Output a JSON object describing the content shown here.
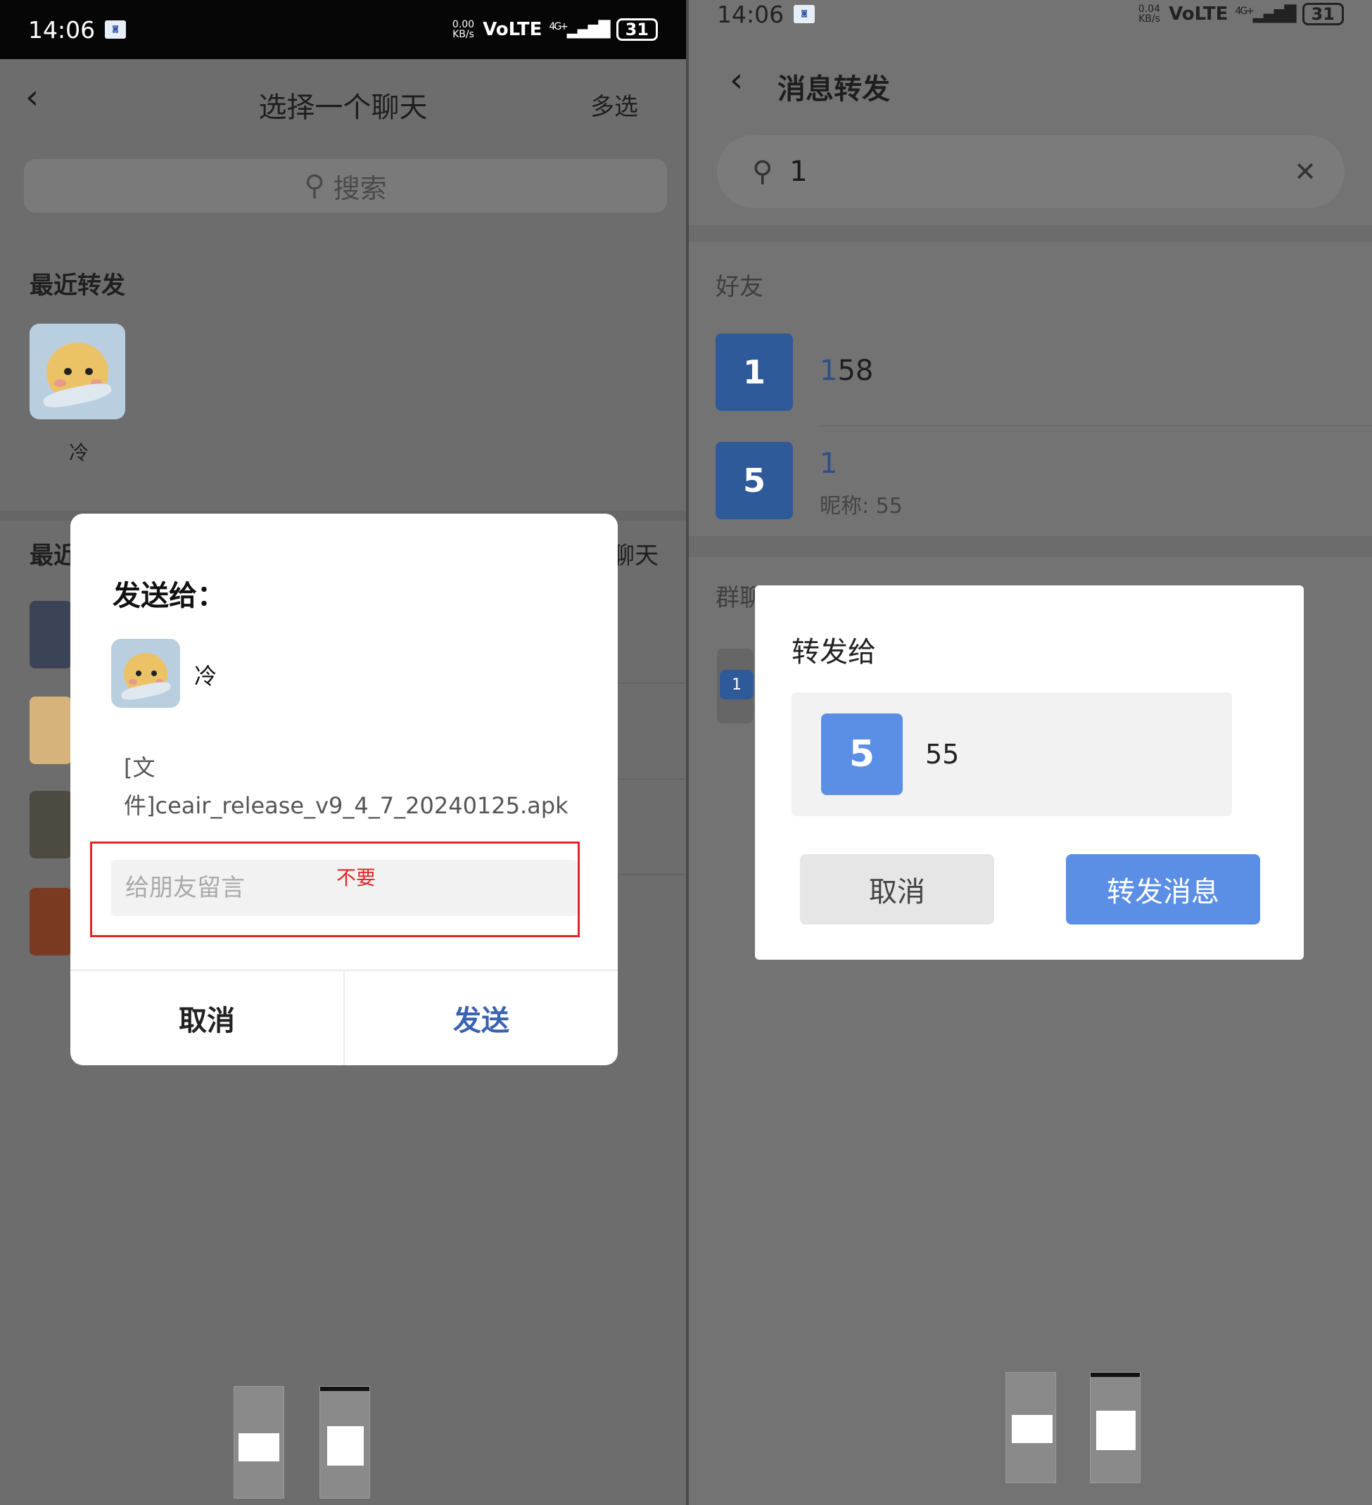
{
  "left": {
    "status": {
      "time": "14:06",
      "net_rate": "0.00",
      "net_unit": "KB/s",
      "volte": "VoLTE",
      "signal": "4G+",
      "battery": "31"
    },
    "header": {
      "title": "选择一个聊天",
      "multi_select": "多选"
    },
    "search": {
      "placeholder": "搜索"
    },
    "recent_forward": {
      "title": "最近转发",
      "items": [
        {
          "name": "冷"
        }
      ]
    },
    "recent_chats": {
      "title_fragment": "最近",
      "right_fragment": "聊天"
    },
    "dialog": {
      "title": "发送给：",
      "recipient": "冷",
      "file_line1": "[文",
      "file_line2": "件]ceair_release_v9_4_7_20240125.apk",
      "message_placeholder": "给朋友留言",
      "cancel": "取消",
      "send": "发送"
    },
    "annotation": {
      "text": "不要",
      "color": "#e12626"
    }
  },
  "right": {
    "status": {
      "time": "14:06",
      "net_rate": "0.04",
      "net_unit": "KB/s",
      "volte": "VoLTE",
      "signal": "4G+",
      "battery": "31"
    },
    "header": {
      "title": "消息转发"
    },
    "search": {
      "query": "1"
    },
    "friends": {
      "title": "好友",
      "items": [
        {
          "avatar": "1",
          "name_highlight": "1",
          "name_rest": "58"
        },
        {
          "avatar": "5",
          "name_highlight": "1",
          "nickname": "昵称: 55"
        }
      ]
    },
    "groups": {
      "title_fragment": "群聊",
      "avatar": "1"
    },
    "dialog": {
      "title": "转发给",
      "target_avatar": "5",
      "target_name": "55",
      "cancel": "取消",
      "forward": "转发消息"
    }
  },
  "colors": {
    "accent_blue": "#5b8fe6",
    "dark_avatar_blue": "#2f5a9a",
    "send_blue": "#3a63b0"
  }
}
